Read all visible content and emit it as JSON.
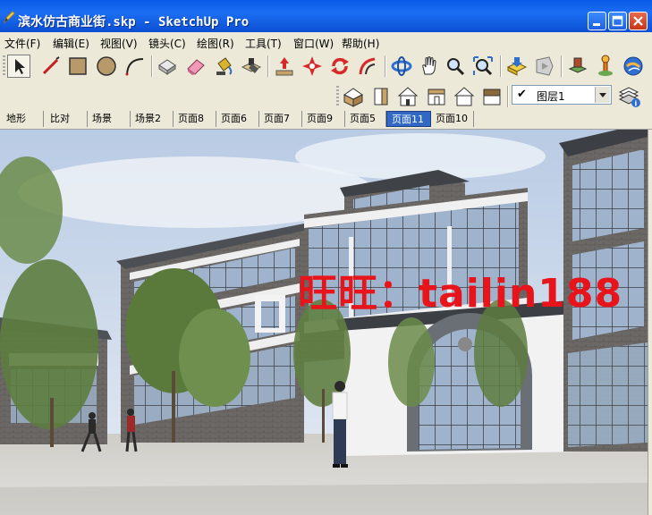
{
  "window": {
    "title": "滨水仿古商业街.skp - SketchUp Pro",
    "icons": {
      "app": "sketchup-pen-icon",
      "minimize": "minimize-icon",
      "maximize": "maximize-icon",
      "close": "close-icon"
    }
  },
  "menu": [
    {
      "label": "文件(F)"
    },
    {
      "label": "编辑(E)"
    },
    {
      "label": "视图(V)"
    },
    {
      "label": "镜头(C)"
    },
    {
      "label": "绘图(R)"
    },
    {
      "label": "工具(T)"
    },
    {
      "label": "窗口(W)"
    },
    {
      "label": "帮助(H)"
    }
  ],
  "toolbar": {
    "tools": [
      "select-arrow-icon",
      "pencil-line-icon",
      "rectangle-icon",
      "circle-icon",
      "arc-icon",
      "make-component-icon",
      "eraser-icon",
      "paint-bucket-icon",
      "push-pull-icon",
      "move-icon",
      "rotate-icon",
      "offset-icon",
      "follow-me-icon",
      "orbit-icon",
      "pan-hand-icon",
      "zoom-icon",
      "zoom-extents-icon",
      "get-models-icon",
      "share-model-icon",
      "place-model-icon",
      "add-location-icon",
      "google-earth-icon"
    ],
    "views": [
      "iso-view-icon",
      "top-view-icon",
      "front-view-icon",
      "right-view-icon",
      "back-view-icon",
      "left-view-icon"
    ],
    "layer": {
      "current": "图层1",
      "check": "✔"
    },
    "layer_manager_icon": "layer-manager-icon"
  },
  "scene_tabs": [
    {
      "label": "地形"
    },
    {
      "label": "比对"
    },
    {
      "label": "场景"
    },
    {
      "label": "场景2"
    },
    {
      "label": "页面8"
    },
    {
      "label": "页面6"
    },
    {
      "label": "页面7"
    },
    {
      "label": "页面9"
    },
    {
      "label": "页面5"
    },
    {
      "label": "页面11",
      "active": true
    },
    {
      "label": "页面10"
    }
  ],
  "viewport": {
    "watermark": "旺旺：tailin188",
    "colors": {
      "sky": "#c7d6ea",
      "ground": "#d8d6d2",
      "wall_white": "#f2f2f2",
      "roof": "#5a5e63",
      "brick": "#6d6a68",
      "tree": "#5d7d3f"
    }
  }
}
